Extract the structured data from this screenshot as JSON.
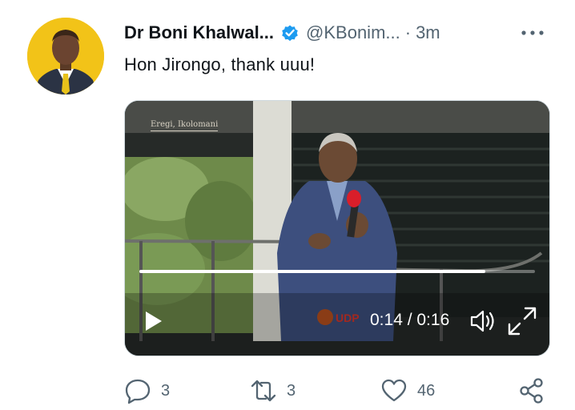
{
  "author": {
    "display_name": "Dr Boni Khalwal...",
    "handle": "@KBonim...",
    "separator": "·",
    "time": "3m"
  },
  "tweet": {
    "text": "Hon Jirongo, thank uuu!"
  },
  "video": {
    "channel_tag": "Eregi, Ikolomani",
    "current_time": "0:14",
    "duration": "0:16",
    "time_display": "0:14 / 0:16",
    "progress_fraction": 0.875
  },
  "actions": {
    "reply_count": "3",
    "retweet_count": "3",
    "like_count": "46"
  },
  "colors": {
    "verified": "#1d9bf0",
    "secondary_text": "#536471",
    "avatar_bg": "#f2c318"
  }
}
